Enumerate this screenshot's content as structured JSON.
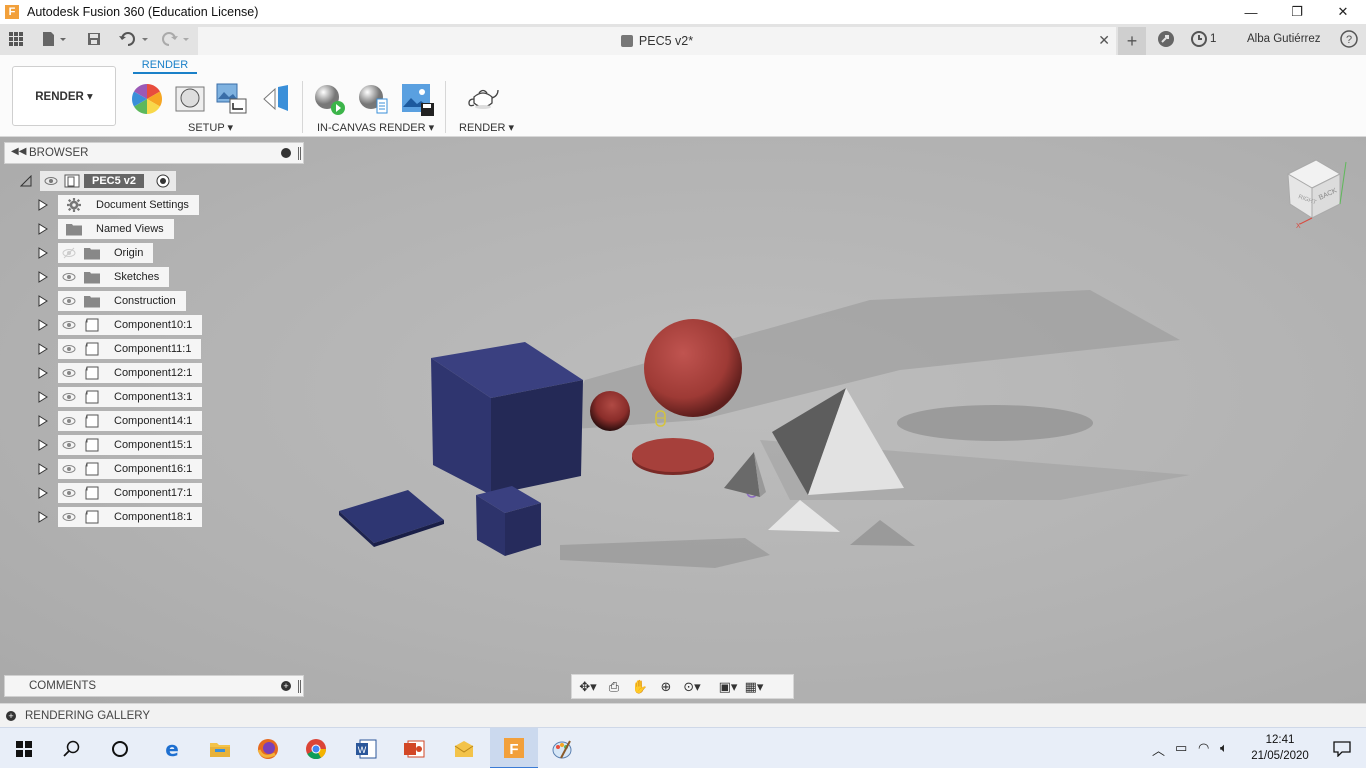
{
  "window": {
    "title": "Autodesk Fusion 360 (Education License)",
    "minimize": "—",
    "maximize": "❐",
    "close": "✕"
  },
  "tabbar": {
    "document_tab": "PEC5 v2*",
    "job_count": "1",
    "user": "Alba Gutiérrez"
  },
  "ribbon": {
    "workspace": "RENDER ▾",
    "active_tab": "RENDER",
    "groups": [
      {
        "label": "SETUP ▾"
      },
      {
        "label": "IN-CANVAS RENDER ▾"
      },
      {
        "label": "RENDER ▾"
      }
    ]
  },
  "browser": {
    "title": "BROWSER",
    "root": "PEC5 v2",
    "items": [
      {
        "label": "Document Settings",
        "icon": "gear-icon"
      },
      {
        "label": "Named Views",
        "icon": "folder-icon"
      },
      {
        "label": "Origin",
        "icon": "folder-icon"
      },
      {
        "label": "Sketches",
        "icon": "folder-icon"
      },
      {
        "label": "Construction",
        "icon": "folder-icon"
      },
      {
        "label": "Component10:1",
        "icon": "component-icon"
      },
      {
        "label": "Component11:1",
        "icon": "component-icon"
      },
      {
        "label": "Component12:1",
        "icon": "component-icon"
      },
      {
        "label": "Component13:1",
        "icon": "component-icon"
      },
      {
        "label": "Component14:1",
        "icon": "component-icon"
      },
      {
        "label": "Component15:1",
        "icon": "component-icon"
      },
      {
        "label": "Component16:1",
        "icon": "component-icon"
      },
      {
        "label": "Component17:1",
        "icon": "component-icon"
      },
      {
        "label": "Component18:1",
        "icon": "component-icon"
      }
    ]
  },
  "viewcube": {
    "right": "RIGHT",
    "back": "BACK"
  },
  "comments": {
    "title": "COMMENTS"
  },
  "gallery": {
    "title": "RENDERING GALLERY"
  },
  "taskbar": {
    "time": "12:41",
    "date": "21/05/2020"
  },
  "colors": {
    "accent": "#1a80c8",
    "cube": "#2e3468",
    "sphere": "#a8423c",
    "pyramid": "#e8e8e8"
  }
}
